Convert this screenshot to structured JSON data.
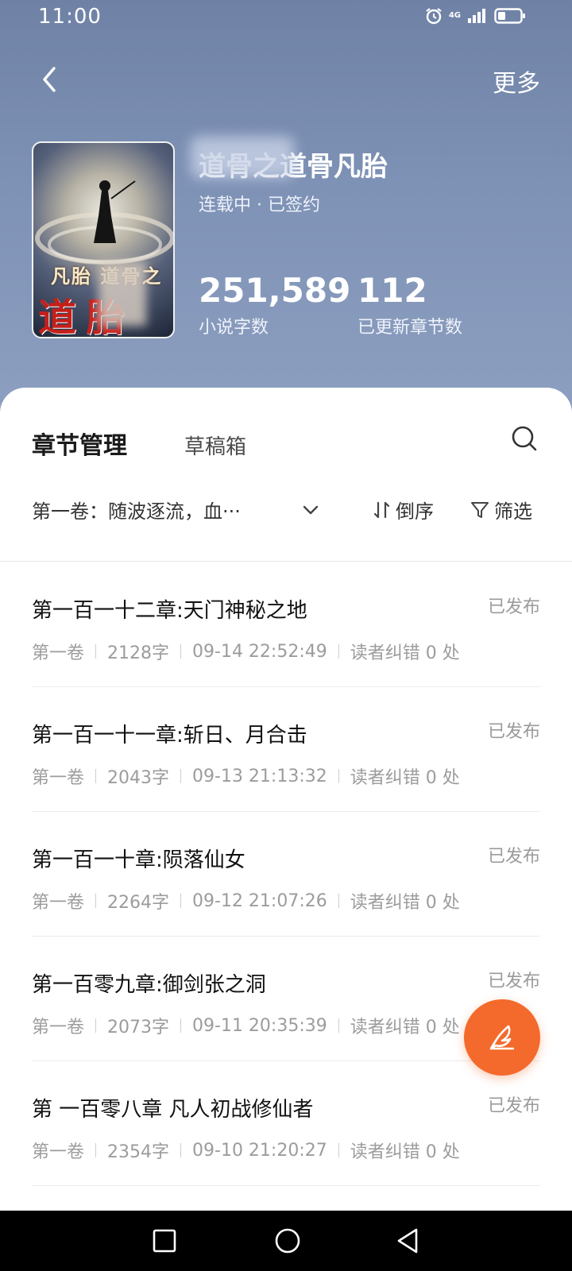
{
  "status_bar": {
    "time": "11:00",
    "network": "4G"
  },
  "topbar": {
    "more_label": "更多"
  },
  "book": {
    "title": "道骨之道骨凡胎",
    "status": "连载中 · 已签约",
    "cover_text_top": "凡胎  道骨之",
    "cover_text_big": "道   胎",
    "word_count": "251,589",
    "word_count_label": "小说字数",
    "chapter_count": "112",
    "chapter_count_label": "已更新章节数"
  },
  "tabs": [
    {
      "label": "章节管理",
      "active": true
    },
    {
      "label": "草稿箱",
      "active": false
    }
  ],
  "filters": {
    "volume": "第一卷：随波逐流，血···",
    "sort_label": "倒序",
    "filter_label": "筛选"
  },
  "chapters": [
    {
      "title": "第一百一十二章:天门神秘之地",
      "status": "已发布",
      "volume": "第一卷",
      "words": "2128字",
      "time": "09-14 22:52:49",
      "errata": "读者纠错 0 处"
    },
    {
      "title": "第一百一十一章:斩日、月合击",
      "status": "已发布",
      "volume": "第一卷",
      "words": "2043字",
      "time": "09-13 21:13:32",
      "errata": "读者纠错 0 处"
    },
    {
      "title": "第一百一十章:陨落仙女",
      "status": "已发布",
      "volume": "第一卷",
      "words": "2264字",
      "time": "09-12 21:07:26",
      "errata": "读者纠错 0 处"
    },
    {
      "title": "第一百零九章:御剑张之洞",
      "status": "已发布",
      "volume": "第一卷",
      "words": "2073字",
      "time": "09-11 20:35:39",
      "errata": "读者纠错 0 处"
    },
    {
      "title": "第 一百零八章 凡人初战修仙者",
      "status": "已发布",
      "volume": "第一卷",
      "words": "2354字",
      "time": "09-10 21:20:27",
      "errata": "读者纠错 0 处"
    }
  ],
  "colors": {
    "header": "#7e92b6",
    "accent": "#f36a2c"
  }
}
